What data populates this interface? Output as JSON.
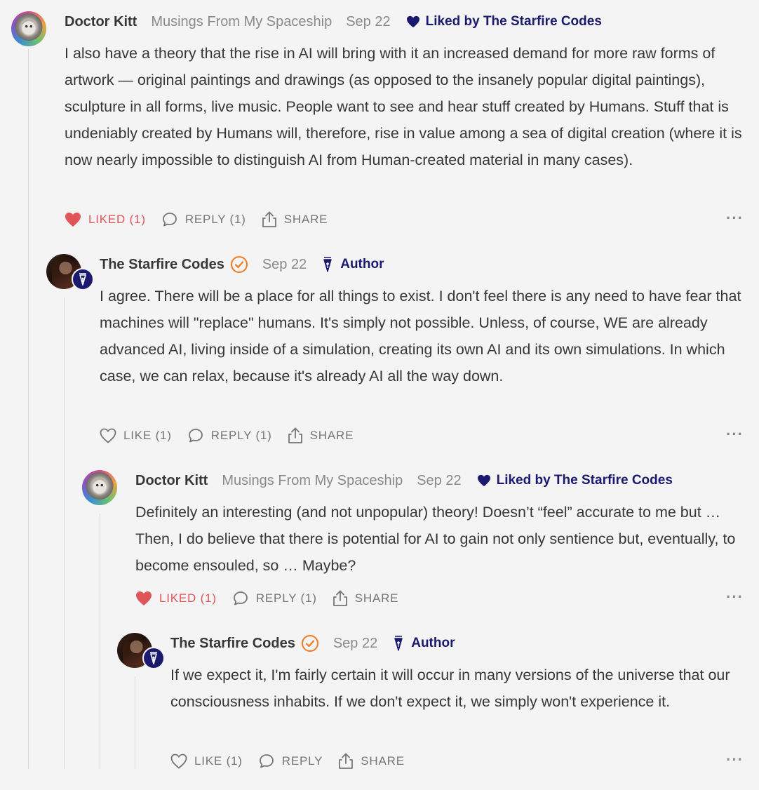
{
  "comments": [
    {
      "author": "Doctor Kitt",
      "publication": "Musings From My Spaceship",
      "date": "Sep 22",
      "liked_by": "Liked by The Starfire Codes",
      "body": "I also have a theory that the rise in AI will bring with it an increased demand for more raw forms of artwork — original paintings and drawings (as opposed to the insanely popular digital paintings), sculpture in all forms, live music. People want to see and hear stuff created by Humans. Stuff that is undeniably created by Humans will, therefore, rise in value among a sea of digital creation (where it is now nearly impossible to distinguish AI from Human-created material in many cases).",
      "like_label": "LIKED (1)",
      "reply_label": "REPLY (1)",
      "share_label": "SHARE",
      "more": "···"
    },
    {
      "author": "The Starfire Codes",
      "date": "Sep 22",
      "author_tag": "Author",
      "body": "I agree. There will be a place for all things to exist. I don't feel there is any need to have fear that machines will \"replace\" humans. It's simply not possible. Unless, of course, WE are already advanced AI, living inside of a simulation, creating its own AI and its own simulations. In which case, we can relax, because it's already AI all the way down.",
      "like_label": "LIKE (1)",
      "reply_label": "REPLY (1)",
      "share_label": "SHARE",
      "more": "···"
    },
    {
      "author": "Doctor Kitt",
      "publication": "Musings From My Spaceship",
      "date": "Sep 22",
      "liked_by": "Liked by The Starfire Codes",
      "body": "Definitely an interesting (and not unpopular) theory! Doesn’t “feel” accurate to me but … Then, I do believe that there is potential for AI to gain not only sentience but, eventually, to become ensouled, so … Maybe?",
      "like_label": "LIKED (1)",
      "reply_label": "REPLY (1)",
      "share_label": "SHARE",
      "more": "···"
    },
    {
      "author": "The Starfire Codes",
      "date": "Sep 22",
      "author_tag": "Author",
      "body": "If we expect it, I'm fairly certain it will occur in many versions of the universe that our consciousness inhabits. If we don't expect it, we simply won't experience it.",
      "like_label": "LIKE (1)",
      "reply_label": "REPLY",
      "share_label": "SHARE",
      "more": "···"
    }
  ],
  "colors": {
    "liked_red": "#e0555a",
    "author_navy": "#1b1a6e",
    "verified_orange": "#f07a22",
    "muted_text": "#8a8a8a"
  }
}
